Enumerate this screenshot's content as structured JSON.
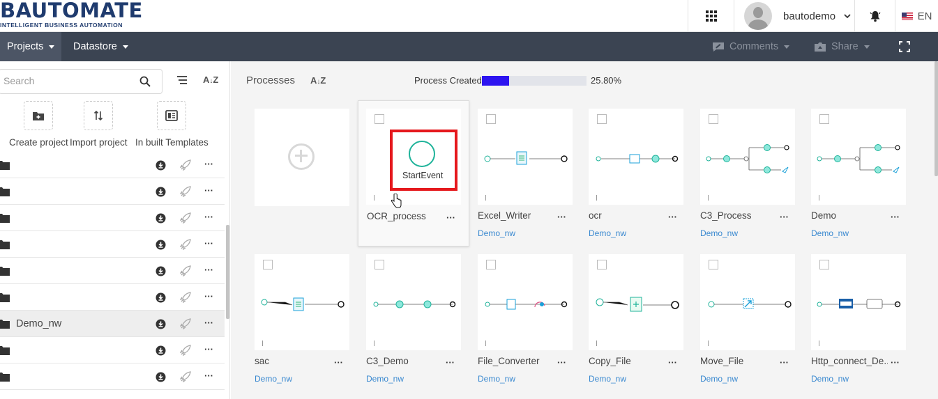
{
  "header": {
    "logo_text": "BAUTOMATE",
    "logo_tagline": "INTELLIGENT BUSINESS AUTOMATION",
    "apps_icon": "grid-icon",
    "username": "bautodemo",
    "notification_icon": "bell-icon",
    "language": "EN"
  },
  "nav": {
    "projects": "Projects",
    "datastore": "Datastore",
    "comments": "Comments",
    "share": "Share",
    "fullscreen_icon": "fullscreen-icon"
  },
  "sidebar": {
    "search_placeholder": "Search",
    "tools": [
      {
        "label": "Create project",
        "icon": "add-folder-icon"
      },
      {
        "label": "Import project",
        "icon": "import-arrows-icon"
      },
      {
        "label": "In built Templates",
        "icon": "template-icon"
      }
    ],
    "projects": [
      {
        "name": ""
      },
      {
        "name": ""
      },
      {
        "name": ""
      },
      {
        "name": ""
      },
      {
        "name": ""
      },
      {
        "name": ""
      },
      {
        "name": "Demo_nw"
      },
      {
        "name": ""
      },
      {
        "name": ""
      }
    ]
  },
  "main": {
    "title": "Processes",
    "sort_label": "AZ",
    "progress_label": "Process Created",
    "progress_value_text": "25.80%",
    "progress_fraction": 0.258,
    "highlight_label": "StartEvent",
    "accent_color": "#2d14f0",
    "highlight_color": "#e5181d",
    "link_color": "#3a89d0",
    "cards": [
      {
        "name": "OCR_process",
        "project": ""
      },
      {
        "name": "Excel_Writer",
        "project": "Demo_nw"
      },
      {
        "name": "ocr",
        "project": "Demo_nw"
      },
      {
        "name": "C3_Process",
        "project": "Demo_nw"
      },
      {
        "name": "Demo",
        "project": "Demo_nw"
      },
      {
        "name": "sac",
        "project": "Demo_nw"
      },
      {
        "name": "C3_Demo",
        "project": "Demo_nw"
      },
      {
        "name": "File_Converter",
        "project": "Demo_nw"
      },
      {
        "name": "Copy_File",
        "project": "Demo_nw"
      },
      {
        "name": "Move_File",
        "project": "Demo_nw"
      },
      {
        "name": "Http_connect_De...",
        "project": "Demo_nw"
      }
    ]
  }
}
